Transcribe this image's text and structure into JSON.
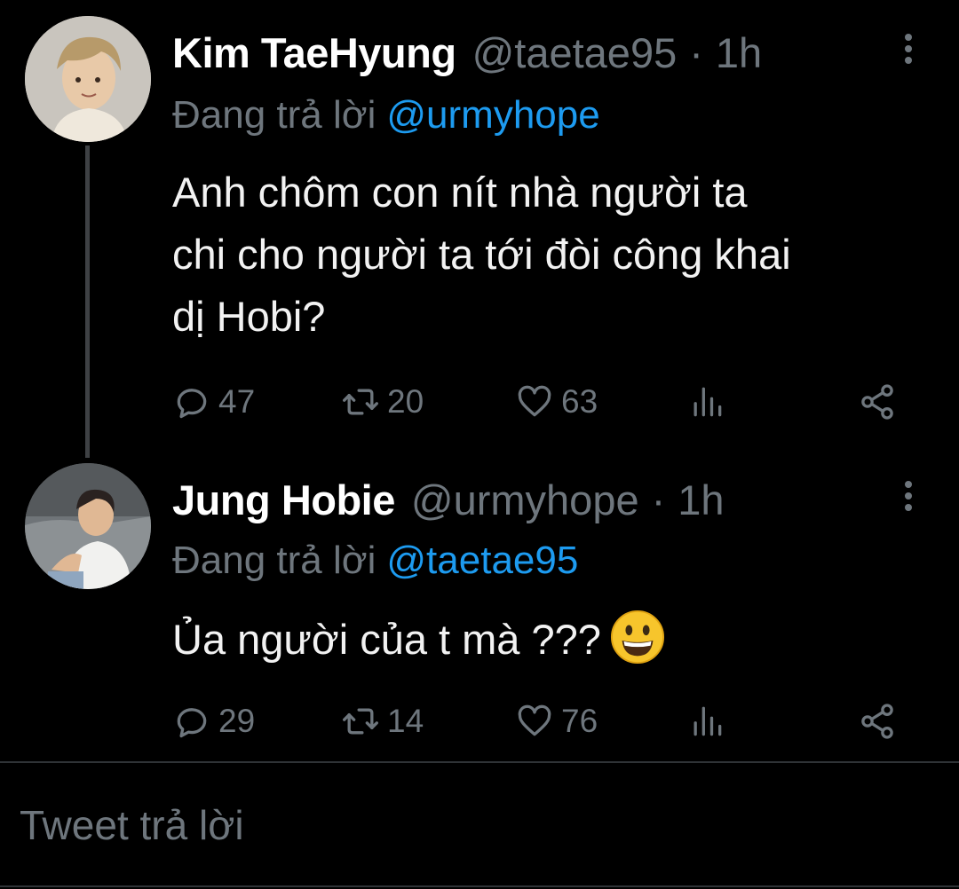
{
  "colors": {
    "background": "#000000",
    "primary_text": "#e7e9ea",
    "secondary_text": "#6e767d",
    "link": "#1d9bf0",
    "divider": "#2f3336"
  },
  "tweets": [
    {
      "author_name": "Kim TaeHyung",
      "handle": "@taetae95",
      "separator": "·",
      "time": "1h",
      "reply_prefix": "Đang trả lời",
      "reply_mention": "@urmyhope",
      "text_lines": [
        "Anh chôm con nít nhà người ta",
        "chi cho người ta tới đòi công khai",
        "dị Hobi?"
      ],
      "replies": "47",
      "retweets": "20",
      "likes": "63",
      "icons": {
        "reply": "reply-icon",
        "retweet": "retweet-icon",
        "like": "heart-icon",
        "analytics": "analytics-icon",
        "share": "share-icon",
        "more": "more-options-icon"
      }
    },
    {
      "author_name": "Jung Hobie",
      "handle": "@urmyhope",
      "separator": "·",
      "time": "1h",
      "reply_prefix": "Đang trả lời",
      "reply_mention": "@taetae95",
      "text": "Ủa người của t mà ???",
      "emoji": "grinning-face-emoji",
      "replies": "29",
      "retweets": "14",
      "likes": "76",
      "icons": {
        "reply": "reply-icon",
        "retweet": "retweet-icon",
        "like": "heart-icon",
        "analytics": "analytics-icon",
        "share": "share-icon",
        "more": "more-options-icon"
      }
    }
  ],
  "composer": {
    "placeholder": "Tweet trả lời"
  }
}
